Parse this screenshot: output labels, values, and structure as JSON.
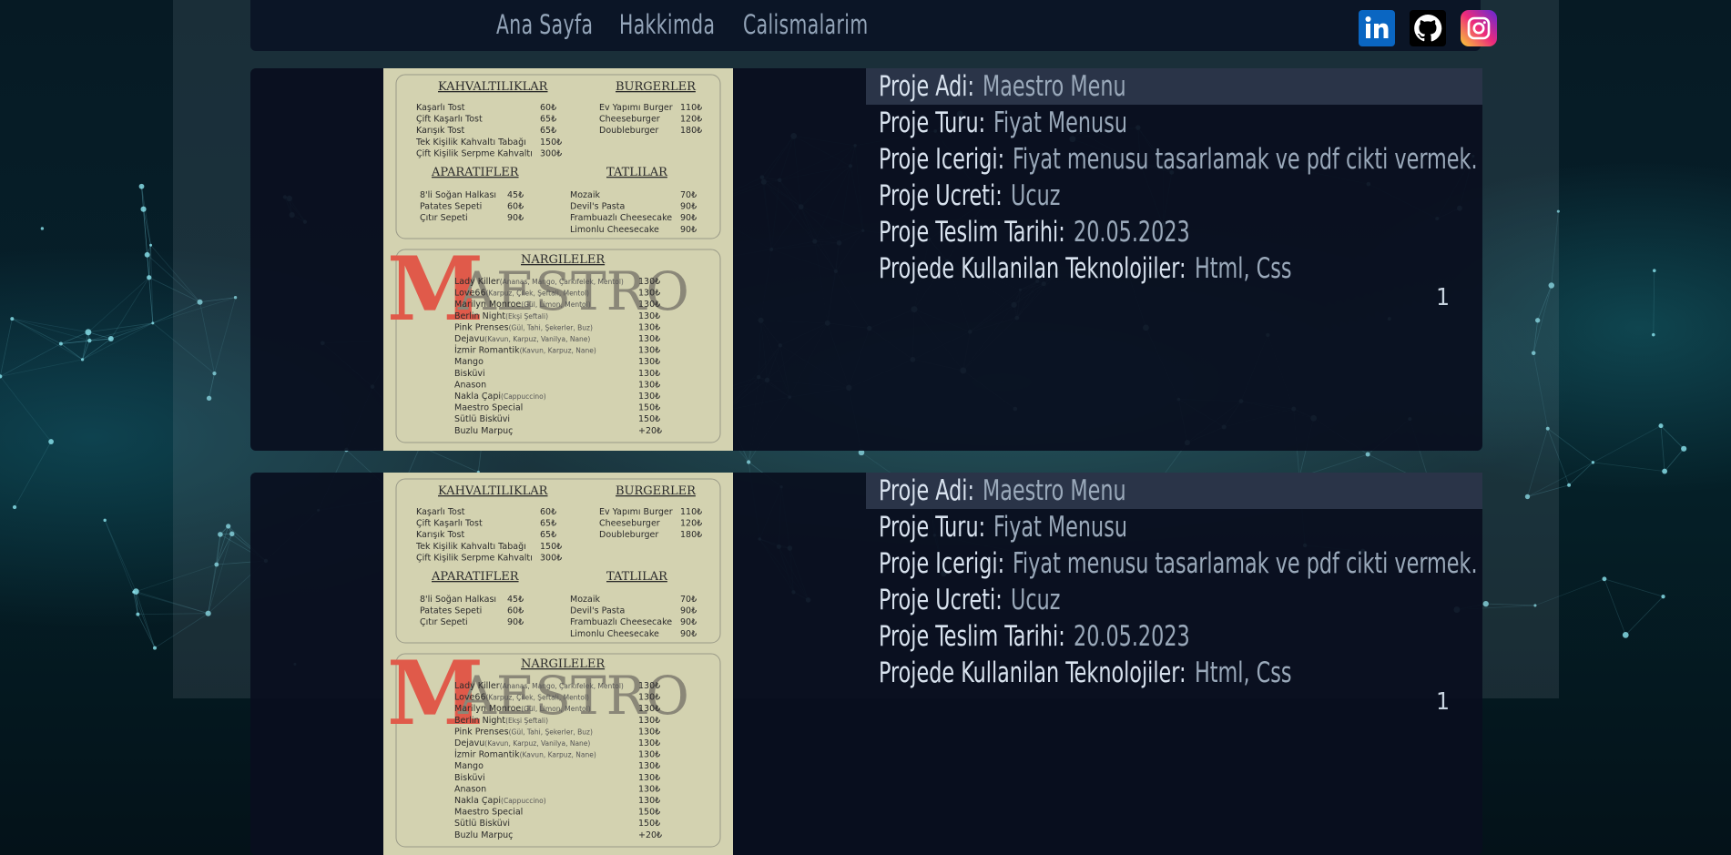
{
  "nav": {
    "items": [
      "Ana Sayfa",
      "Hakkimda",
      "Calismalarim"
    ],
    "socials": [
      "linkedin-icon",
      "github-icon",
      "instagram-icon"
    ]
  },
  "menu": {
    "logo": "MAESTRO",
    "sections": {
      "kahvalti": {
        "title": "KAHVALTILIKLAR",
        "items": [
          [
            "Kaşarlı Tost",
            "60₺"
          ],
          [
            "Çift Kaşarlı Tost",
            "65₺"
          ],
          [
            "Karışık Tost",
            "65₺"
          ],
          [
            "Tek Kişilik Kahvaltı Tabağı",
            "150₺"
          ],
          [
            "Çift Kişilik Serpme Kahvaltı",
            "300₺"
          ]
        ]
      },
      "burger": {
        "title": "BURGERLER",
        "items": [
          [
            "Ev Yapımı Burger",
            "110₺"
          ],
          [
            "Cheeseburger",
            "120₺"
          ],
          [
            "Doubleburger",
            "180₺"
          ]
        ]
      },
      "aparatif": {
        "title": "APARATIFLER",
        "items": [
          [
            "8'li Soğan Halkası",
            "45₺"
          ],
          [
            "Patates Sepeti",
            "60₺"
          ],
          [
            "Çıtır Sepeti",
            "90₺"
          ]
        ]
      },
      "tatli": {
        "title": "TATLILAR",
        "items": [
          [
            "Mozaik",
            "70₺"
          ],
          [
            "Devil's Pasta",
            "90₺"
          ],
          [
            "Frambuazlı Cheesecake",
            "90₺"
          ],
          [
            "Limonlu Cheesecake",
            "90₺"
          ]
        ]
      },
      "nargile": {
        "title": "NARGILELER",
        "items": [
          [
            "Lady Killer",
            "(Ananas, Mango, Çarkıfelek, Mentol)",
            "130₺"
          ],
          [
            "Love66",
            "(Karpuz, Çilek, Şeftali, Mentol)",
            "130₺"
          ],
          [
            "Marilyn Monroe",
            "(Gül, Limon, Mentol)",
            "130₺"
          ],
          [
            "Berlin Night",
            "(Ekşi Şeftali)",
            "130₺"
          ],
          [
            "Pink Prenses",
            "(Gül, Tahi, Şekerler, Buz)",
            "130₺"
          ],
          [
            "Dejavu",
            "(Kavun, Karpuz, Vanilya, Nane)",
            "130₺"
          ],
          [
            "İzmir Romantik",
            "(Kavun, Karpuz, Nane)",
            "130₺"
          ],
          [
            "Mango",
            "",
            "130₺"
          ],
          [
            "Bisküvi",
            "",
            "130₺"
          ],
          [
            "Anason",
            "",
            "130₺"
          ],
          [
            "Nakla Çapi",
            "(Cappuccino)",
            "130₺"
          ],
          [
            "Maestro Special",
            "",
            "150₺"
          ],
          [
            "Sütlü Bisküvi",
            "",
            "150₺"
          ],
          [
            "Buzlu Marpuç",
            "",
            "+20₺"
          ]
        ]
      }
    }
  },
  "projects": [
    {
      "fields": [
        {
          "label": "Proje Adi:",
          "value": "Maestro Menu"
        },
        {
          "label": "Proje Turu:",
          "value": "Fiyat Menusu"
        },
        {
          "label": "Proje Icerigi:",
          "value": "Fiyat menusu tasarlamak ve pdf cikti vermek."
        },
        {
          "label": "Proje Ucreti:",
          "value": "Ucuz"
        },
        {
          "label": "Proje Teslim Tarihi:",
          "value": "20.05.2023"
        },
        {
          "label": "Projede Kullanilan Teknolojiler:",
          "value": "Html, Css"
        }
      ],
      "page": "1"
    },
    {
      "fields": [
        {
          "label": "Proje Adi:",
          "value": "Maestro Menu"
        },
        {
          "label": "Proje Turu:",
          "value": "Fiyat Menusu"
        },
        {
          "label": "Proje Icerigi:",
          "value": "Fiyat menusu tasarlamak ve pdf cikti vermek."
        },
        {
          "label": "Proje Ucreti:",
          "value": "Ucuz"
        },
        {
          "label": "Proje Teslim Tarihi:",
          "value": "20.05.2023"
        },
        {
          "label": "Projede Kullanilan Teknolojiler:",
          "value": "Html, Css"
        }
      ],
      "page": "1"
    }
  ],
  "colors": {
    "accent_logo": "#e05a4a",
    "logo_gray": "#8a8778"
  }
}
